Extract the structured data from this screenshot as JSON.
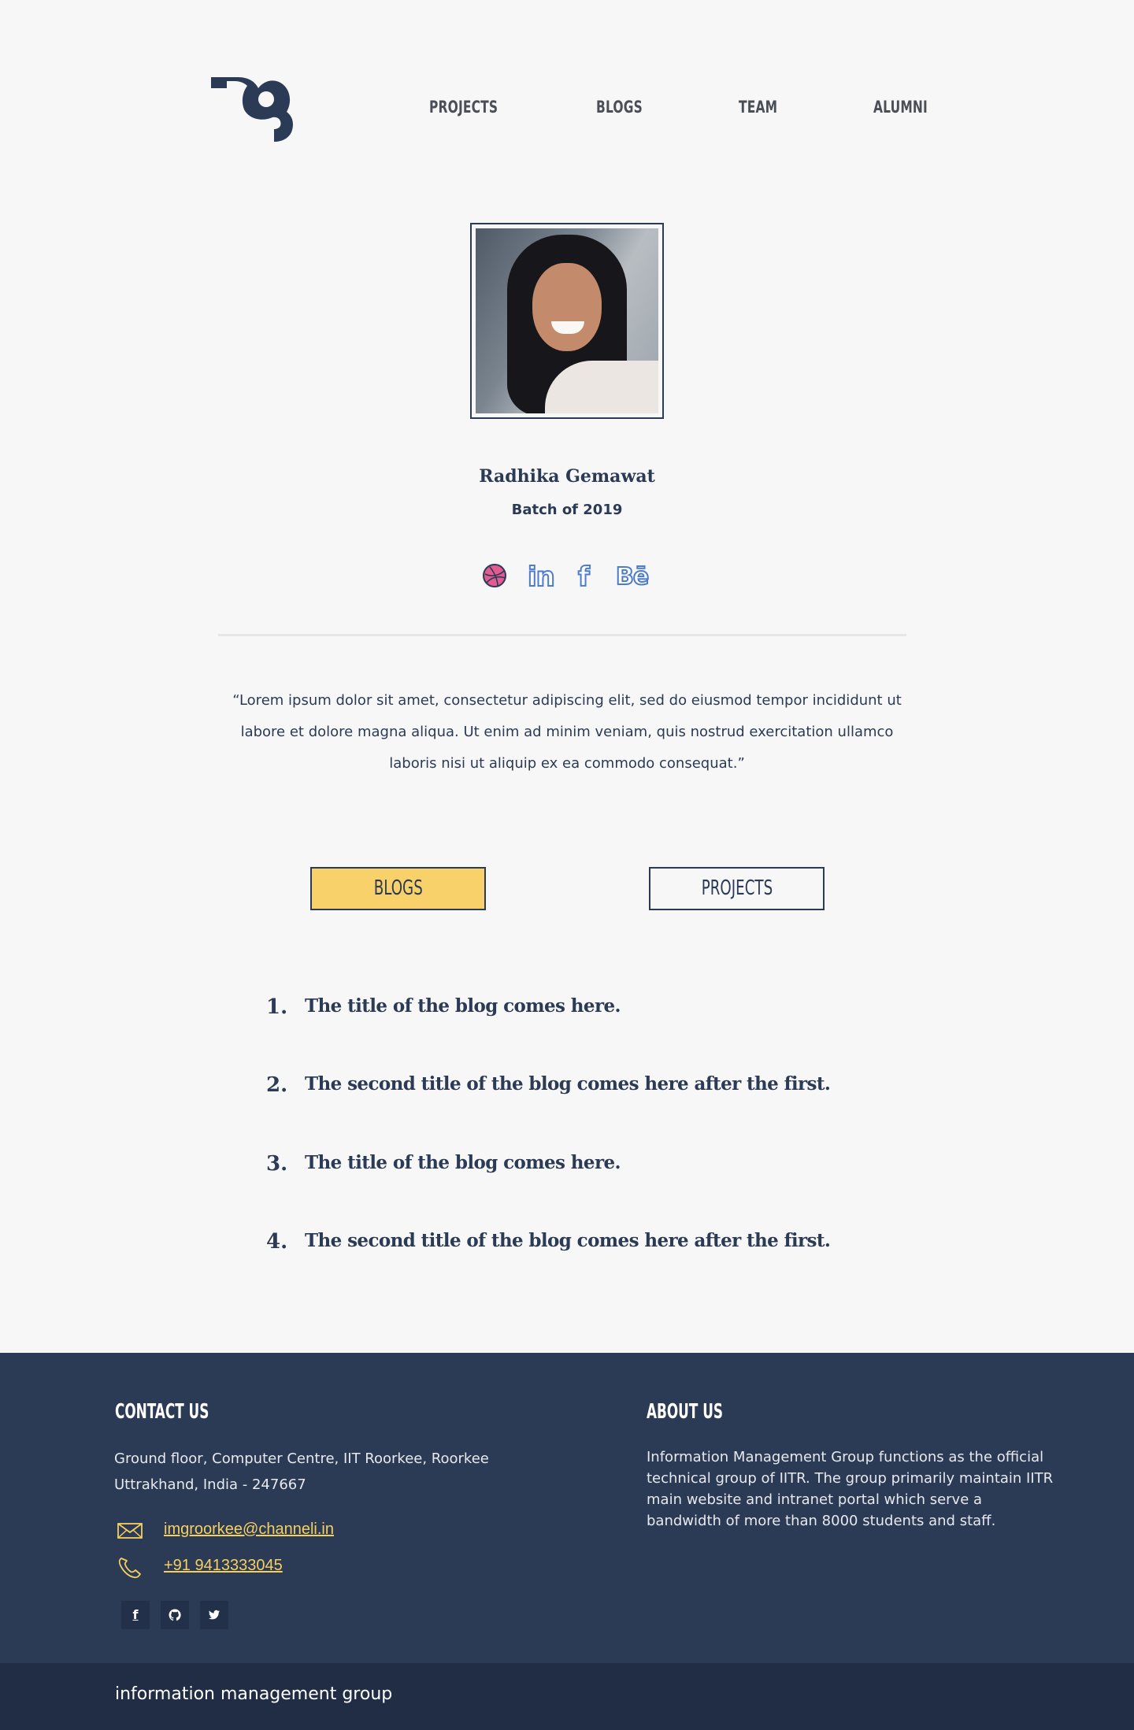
{
  "nav": {
    "logo_icon": "img-logo-icon",
    "items": [
      {
        "label": "PROJECTS"
      },
      {
        "label": "BLOGS"
      },
      {
        "label": "TEAM"
      },
      {
        "label": "ALUMNI"
      }
    ]
  },
  "profile": {
    "name": "Radhika Gemawat",
    "batch": "Batch of 2019",
    "social": [
      {
        "icon": "dribbble-icon",
        "color": "#e35b8f"
      },
      {
        "icon": "linkedin-icon",
        "label": "in",
        "color": "#4d7ccb"
      },
      {
        "icon": "facebook-icon",
        "label": "f",
        "color": "#4d7ccb"
      },
      {
        "icon": "behance-icon",
        "label": "Bē",
        "color": "#4d7ccb"
      }
    ],
    "quote": "“Lorem ipsum dolor sit amet, consectetur adipiscing elit, sed do eiusmod tempor incididunt ut labore et dolore magna aliqua. Ut enim ad minim veniam, quis nostrud exercitation ullamco laboris nisi ut aliquip ex ea commodo consequat.”"
  },
  "tabs": {
    "active": "BLOGS",
    "active_color": "#f8d16a",
    "items": [
      {
        "label": "BLOGS"
      },
      {
        "label": "PROJECTS"
      }
    ]
  },
  "blogs": [
    {
      "num": "1.",
      "title": "The title of the blog comes here."
    },
    {
      "num": "2.",
      "title": "The second title of the blog comes here after the first."
    },
    {
      "num": "3.",
      "title": "The title of the blog comes here."
    },
    {
      "num": "4.",
      "title": "The second title of the blog comes here after the first."
    }
  ],
  "footer": {
    "contact_heading": "CONTACT US",
    "address_line1": "Ground floor, Computer Centre, IIT Roorkee, Roorkee",
    "address_line2": "Uttrakhand, India - 247667",
    "email": "imgroorkee@channeli.in",
    "phone": "+91 9413333045",
    "about_heading": "ABOUT US",
    "about_text": "Information Management Group functions as the official technical group of IITR. The group primarily maintain IITR main website and intranet portal which serve a bandwidth of more than 8000 students and staff.",
    "social": [
      {
        "icon": "facebook-icon",
        "label": "f"
      },
      {
        "icon": "github-icon"
      },
      {
        "icon": "twitter-icon"
      }
    ],
    "bottom_text": "information management group",
    "colors": {
      "footer_bg": "#2b3a55",
      "bottom_bg": "#212d44",
      "accent": "#f5d05f"
    }
  }
}
